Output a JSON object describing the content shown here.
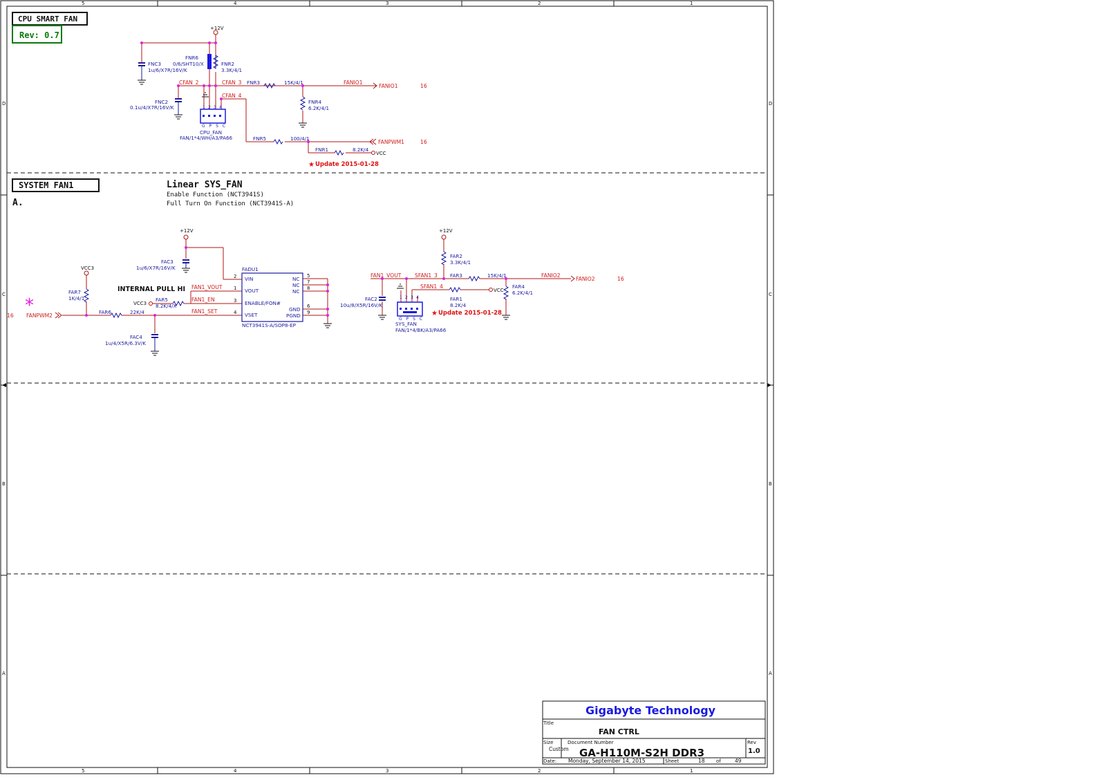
{
  "border": {
    "cols_top": [
      "5",
      "4",
      "3",
      "2",
      "1"
    ],
    "rows_left": [
      "D",
      "C",
      "B",
      "A"
    ]
  },
  "cpu_section": {
    "title": "CPU SMART FAN",
    "rev": "Rev: 0.7",
    "plus12": "+12V",
    "fnc3": {
      "ref": "FNC3",
      "val": "1u/6/X7R/16V/K"
    },
    "fnr6": {
      "ref": "FNR6",
      "val": "0/6/SHT10/X"
    },
    "fnr2": {
      "ref": "FNR2",
      "val": "3.3K/4/1"
    },
    "fnc2": {
      "ref": "FNC2",
      "val": "0.1u/4/X7R/16V/K"
    },
    "cfan2": "CFAN_2",
    "cfan3": "CFAN_3",
    "cfan4": "CFAN_4",
    "fnr3": {
      "ref": "FNR3",
      "val": "15K/4/1"
    },
    "fanio1_net": "FANIO1",
    "fanio1_port": "FANIO1",
    "fanio1_page": "16",
    "fnr4": {
      "ref": "FNR4",
      "val": "6.2K/4/1"
    },
    "pin_numbers": [
      "1",
      "2",
      "3",
      "4"
    ],
    "pin_names": "G P S C",
    "cpu_fan": {
      "ref": "CPU_FAN",
      "val": "FAN/1*4/WH/A3/PA66"
    },
    "fnr5": {
      "ref": "FNR5",
      "val": "100/4/1"
    },
    "fanpwm1": "FANPWM1",
    "fanpwm1_page": "16",
    "fnr1": {
      "ref": "FNR1",
      "val": "8.2K/4"
    },
    "vcc": "VCC",
    "update": "Update 2015-01-28"
  },
  "sys_section": {
    "title": "SYSTEM FAN1",
    "label_a": "A.",
    "heading": "Linear SYS_FAN",
    "line1": "Enable Function (NCT3941S)",
    "line2": "Full Turn On Function (NCT3941S-A)",
    "plus12_a": "+12V",
    "plus12_b": "+12V",
    "fac3": {
      "ref": "FAC3",
      "val": "1u/6/X7R/16V/K"
    },
    "vcc3_top": "VCC3",
    "far7": {
      "ref": "FAR7",
      "val": "1K/4/1"
    },
    "internal": "INTERNAL PULL HI",
    "vcc3_mid": "VCC3",
    "far5": {
      "ref": "FAR5",
      "val": "8.2K/4/X"
    },
    "far6": {
      "ref": "FAR6",
      "val": "22K/4"
    },
    "fanpwm2_page": "16",
    "fanpwm2": "FANPWM2",
    "fac4": {
      "ref": "FAC4",
      "val": "1u/4/X5R/6.3V/K"
    },
    "fan1_vout": "FAN1_VOUT",
    "fan1_en": "FAN1_EN",
    "fan1_set": "FAN1_SET",
    "ic": {
      "ref": "FADU1",
      "part": "NCT3941S-A/SOP8-EP",
      "left_pins": [
        {
          "num": "2",
          "name": "VIN"
        },
        {
          "num": "1",
          "name": "VOUT"
        },
        {
          "num": "3",
          "name": "ENABLE/FON#"
        },
        {
          "num": "4",
          "name": "VSET"
        }
      ],
      "right_pins": [
        {
          "num": "5",
          "name": "NC"
        },
        {
          "num": "7",
          "name": "NC"
        },
        {
          "num": "8",
          "name": "NC"
        },
        {
          "num": "6",
          "name": "GND"
        },
        {
          "num": "9",
          "name": "PGND"
        }
      ]
    },
    "fan1_vout_right": "FAN1_VOUT",
    "sfan1_3": "SFAN1_3",
    "sfan1_4": "SFAN1_4",
    "fac2": {
      "ref": "FAC2",
      "val": "10u/8/X5R/16V/K"
    },
    "far2": {
      "ref": "FAR2",
      "val": "3.3K/4/1"
    },
    "far3": {
      "ref": "FAR3",
      "val": "15K/4/1"
    },
    "fanio2_net": "FANIO2",
    "fanio2_port": "FANIO2",
    "fanio2_page": "16",
    "far1": {
      "ref": "FAR1",
      "val": "8.2K/4"
    },
    "far4": {
      "ref": "FAR4",
      "val": "6.2K/4/1"
    },
    "vcc": "VCC",
    "pin_numbers": [
      "1",
      "2",
      "3",
      "4"
    ],
    "pin_names": "G P S C",
    "sys_fan": {
      "ref": "SYS_FAN",
      "val": "FAN/1*4/BK/A3/PA66"
    },
    "update": "Update 2015-01-28"
  },
  "title_block": {
    "company": "Gigabyte Technology",
    "title_label": "Title",
    "title": "FAN CTRL",
    "size_label": "Size",
    "size": "Custom",
    "docnum_label": "Document Number",
    "docnum": "GA-H110M-S2H DDR3",
    "rev_label": "Rev",
    "rev": "1.0",
    "date_label": "Date:",
    "date": "Monday, September 14, 2015",
    "sheet_label": "Sheet",
    "sheet": "18",
    "of_label": "of",
    "total": "49"
  },
  "colors": {
    "wire": "#b01515",
    "component": "#1a1aa0",
    "junction": "#e020e0",
    "title_blue": "#1a1ae0",
    "rev_green": "#0a7a0a"
  }
}
